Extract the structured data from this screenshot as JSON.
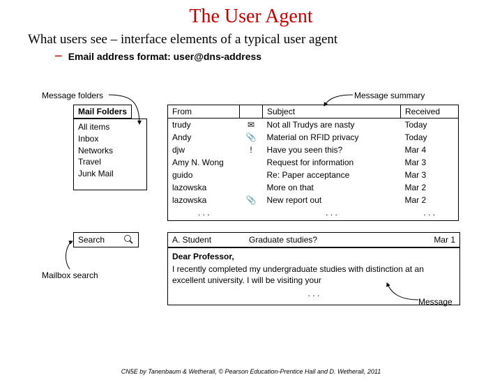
{
  "slide": {
    "title": "The User Agent",
    "subtitle": "What users see – interface elements of a typical user agent",
    "bullet": "Email address format: user@dns-address",
    "footer": "CN5E by Tanenbaum & Wetherall, © Pearson Education-Prentice Hall and D. Wetherall, 2011"
  },
  "callouts": {
    "message_folders": "Message folders",
    "mailbox_search": "Mailbox search",
    "message_summary": "Message summary",
    "message": "Message"
  },
  "folders": {
    "header": "Mail Folders",
    "items": [
      "All items",
      "Inbox",
      "Networks",
      "Travel",
      "Junk Mail"
    ]
  },
  "search": {
    "label": "Search"
  },
  "columns": {
    "from": "From",
    "flag": "",
    "subject": "Subject",
    "received": "Received"
  },
  "messages": [
    {
      "from": "trudy",
      "icon": "envelope",
      "subject": "Not all Trudys are nasty",
      "received": "Today"
    },
    {
      "from": "Andy",
      "icon": "clip",
      "subject": "Material on RFID privacy",
      "received": "Today"
    },
    {
      "from": "djw",
      "icon": "bang",
      "subject": "Have you seen this?",
      "received": "Mar 4"
    },
    {
      "from": "Amy N. Wong",
      "icon": "",
      "subject": "Request for information",
      "received": "Mar 3"
    },
    {
      "from": "guido",
      "icon": "",
      "subject": "Re: Paper acceptance",
      "received": "Mar 3"
    },
    {
      "from": "lazowska",
      "icon": "",
      "subject": "More on that",
      "received": "Mar 2"
    },
    {
      "from": "lazowska",
      "icon": "clip",
      "subject": "New report out",
      "received": "Mar 2"
    }
  ],
  "ellipsis": ". . .",
  "preview": {
    "from": "A. Student",
    "subject": "Graduate studies?",
    "received": "Mar 1",
    "salutation": "Dear Professor,",
    "body": "I recently completed my undergraduate studies with distinction at an excellent university. I will be visiting your"
  },
  "icons": {
    "envelope": "✉",
    "clip": "📎",
    "bang": "!"
  }
}
